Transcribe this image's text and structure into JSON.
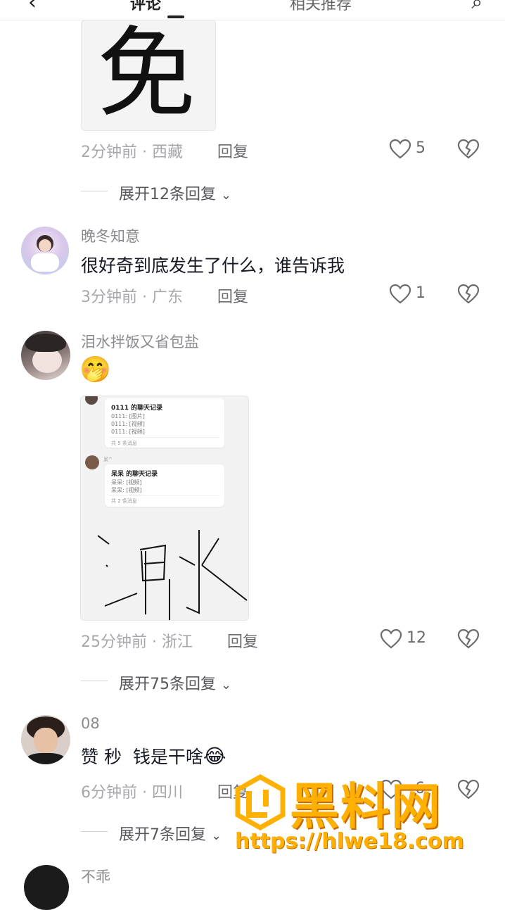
{
  "top_bar": {
    "tab_left": "评论",
    "tab_right": "相关推荐"
  },
  "comment1": {
    "image_char": "免",
    "time": "2分钟前",
    "location": "西藏",
    "reply": "回复",
    "likes": "5",
    "expand": "展开12条回复"
  },
  "comment2": {
    "username": "晚冬知意",
    "text": "很好奇到底发生了什么，谁告诉我",
    "time": "3分钟前",
    "location": "广东",
    "reply": "回复",
    "likes": "1"
  },
  "comment3": {
    "username": "泪水拌饭又省包盐",
    "emoji": "🤭",
    "chat_image": {
      "card1_title": "0111 的聊天记录",
      "card1_lines": [
        "0111: [图片]",
        "0111: [视频]",
        "0111: [视频]"
      ],
      "card1_footer": "共 5 条消息",
      "sender2": "呆^",
      "card2_title": "呆呆 的聊天记录",
      "card2_lines": [
        "呆呆: [视频]",
        "呆呆: [视频]"
      ],
      "card2_footer": "共 2 条消息"
    },
    "time": "25分钟前",
    "location": "浙江",
    "reply": "回复",
    "likes": "12",
    "expand": "展开75条回复"
  },
  "comment4": {
    "username": "08",
    "text": "赞 秒  钱是干啥",
    "emoji": "😂",
    "time": "6分钟前",
    "location": "四川",
    "reply": "回复",
    "likes": "6",
    "expand": "展开7条回复"
  },
  "comment5": {
    "username": "不乖"
  },
  "watermark": {
    "logo_text": "黑料网",
    "url": "https://hlwe18.com",
    "color": "#ffb000"
  }
}
